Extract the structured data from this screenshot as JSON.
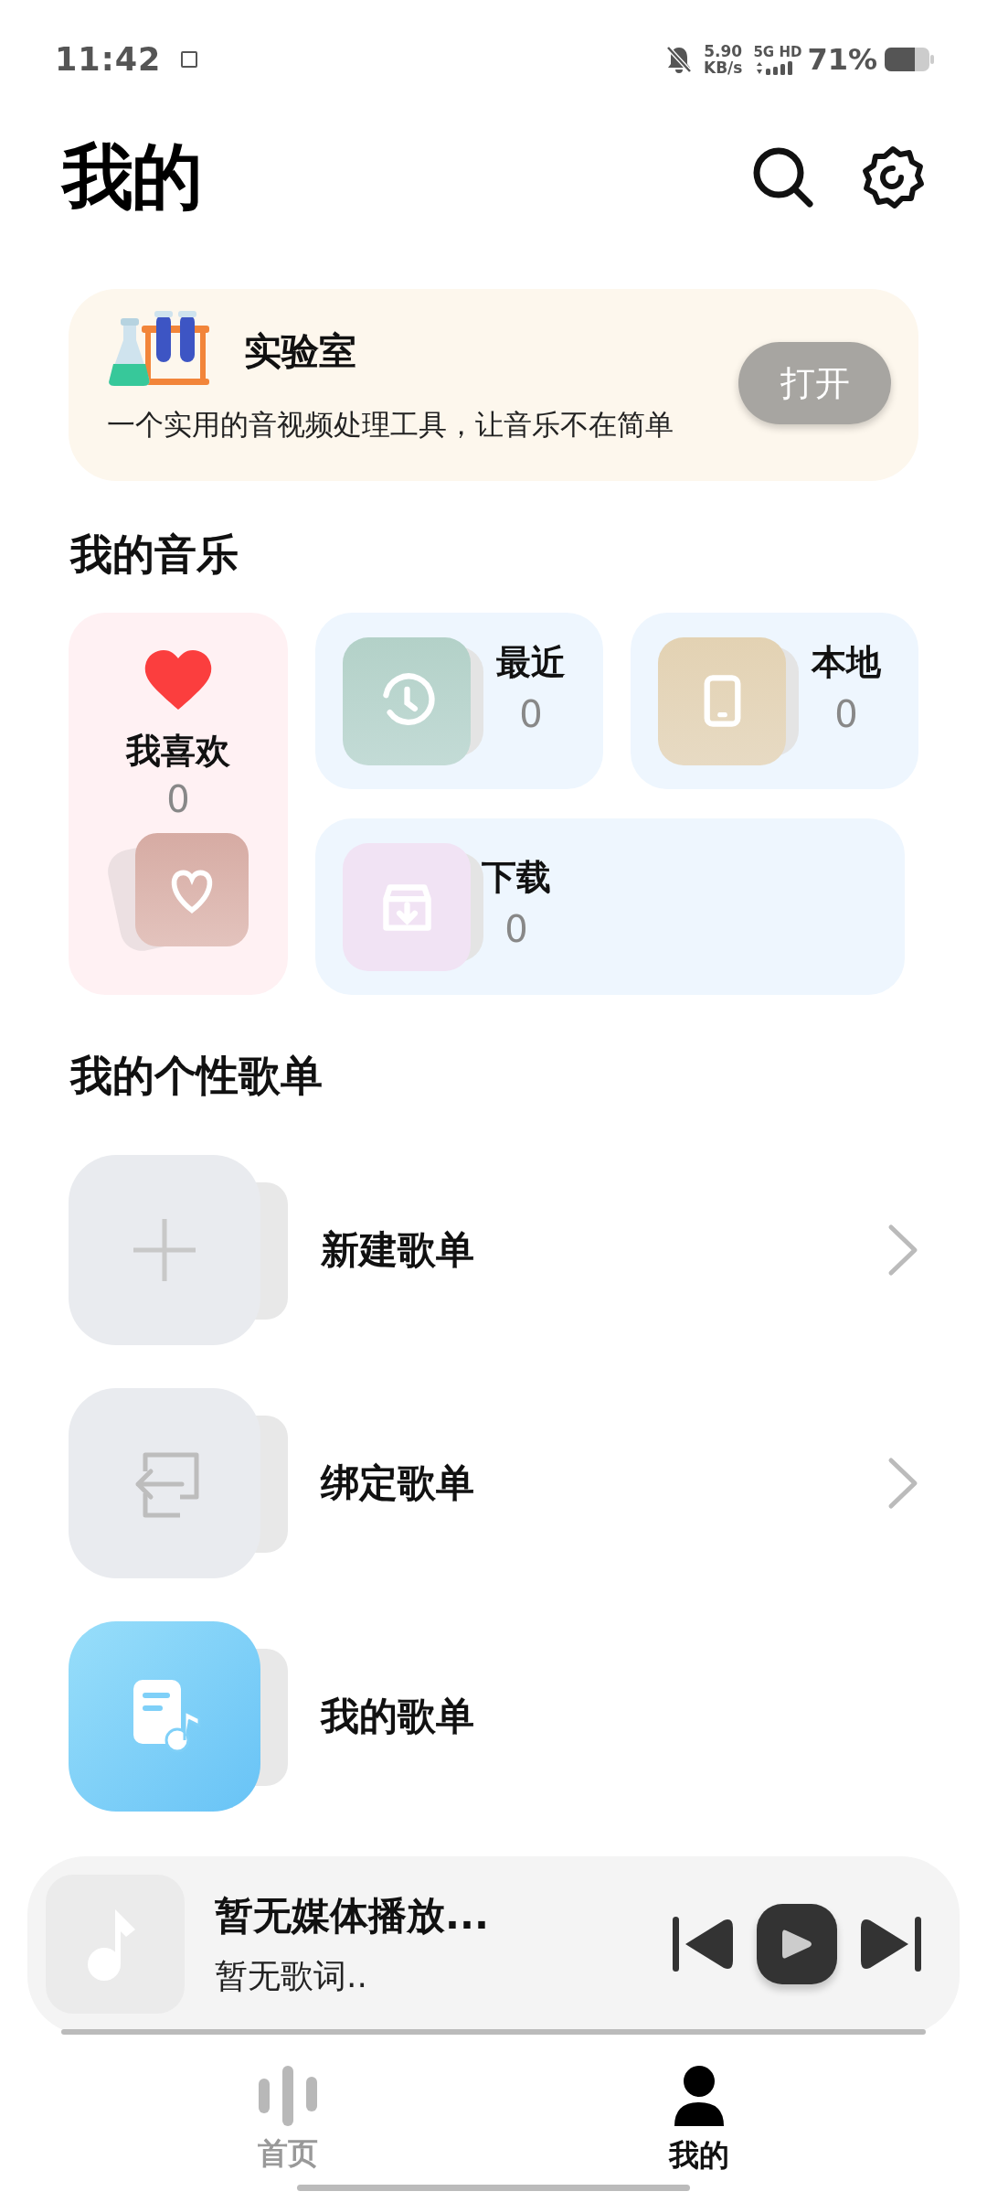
{
  "status_bar": {
    "time": "11:42",
    "net_speed": "5.90",
    "net_unit": "KB/s",
    "network": "5G HD",
    "battery": "71%"
  },
  "header": {
    "title": "我的"
  },
  "lab": {
    "title": "实验室",
    "description": "一个实用的音视频处理工具，让音乐不在简单",
    "button": "打开"
  },
  "my_music": {
    "title": "我的音乐",
    "items": [
      {
        "kind": "liked",
        "label": "我喜欢",
        "count": "0"
      },
      {
        "kind": "recent",
        "label": "最近",
        "count": "0"
      },
      {
        "kind": "local",
        "label": "本地",
        "count": "0"
      },
      {
        "kind": "download",
        "label": "下载",
        "count": "0"
      }
    ]
  },
  "playlists": {
    "title": "我的个性歌单",
    "items": [
      {
        "kind": "new",
        "label": "新建歌单",
        "arrow": true
      },
      {
        "kind": "bind",
        "label": "绑定歌单",
        "arrow": true
      },
      {
        "kind": "mine",
        "label": "我的歌单",
        "arrow": false
      }
    ]
  },
  "player": {
    "title": "暂无媒体播放...",
    "lyric": "暂无歌词..",
    "playing": false
  },
  "nav": {
    "tabs": [
      {
        "kind": "home",
        "label": "首页",
        "selected": false
      },
      {
        "kind": "me",
        "label": "我的",
        "selected": true
      }
    ]
  }
}
